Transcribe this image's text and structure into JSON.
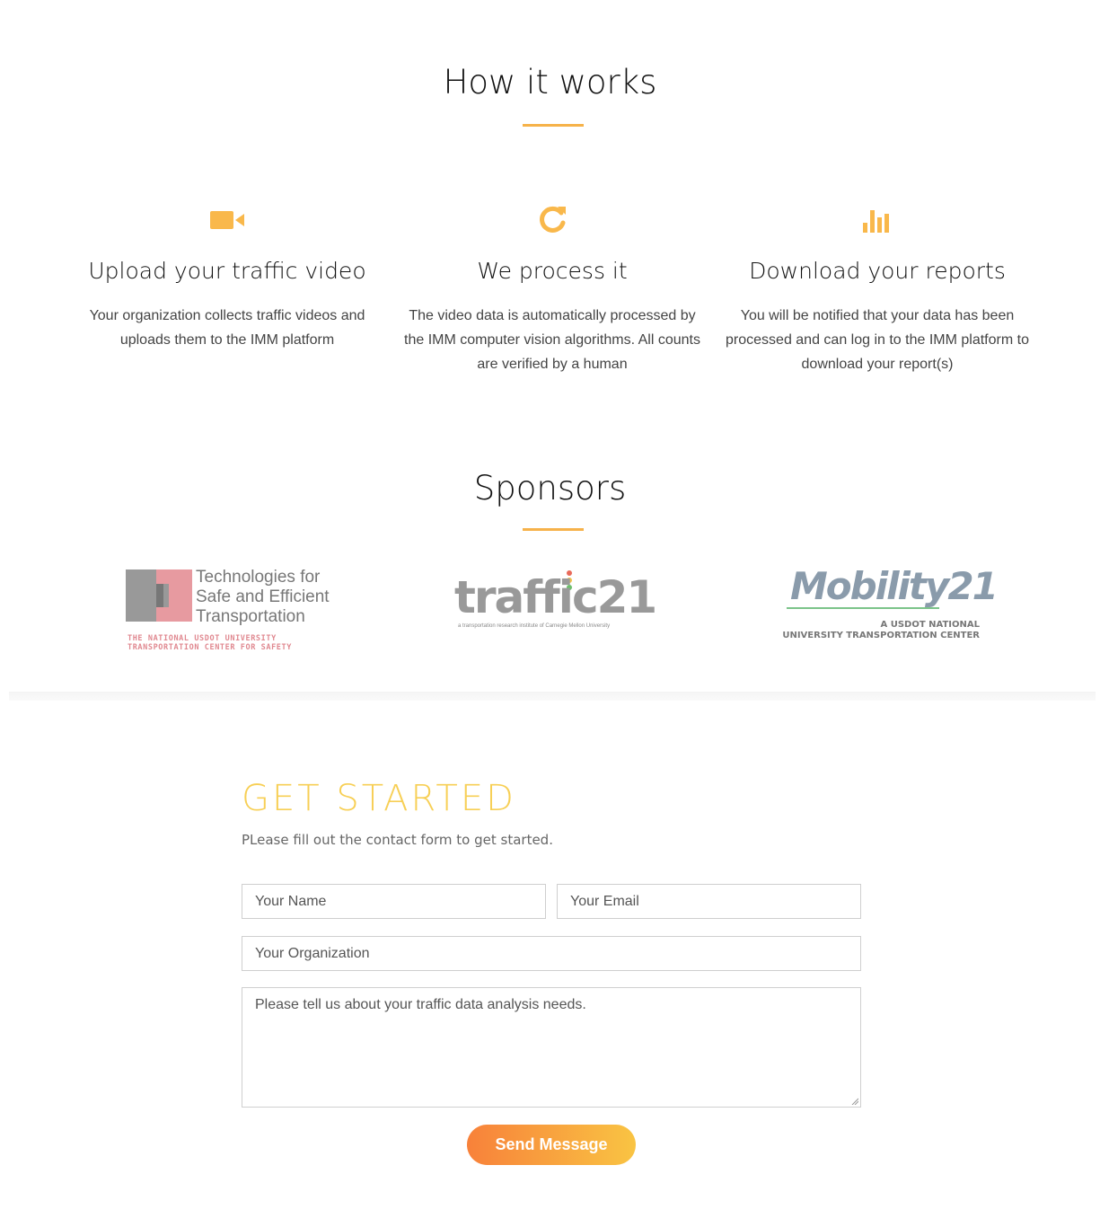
{
  "how_it_works": {
    "title": "How it works",
    "steps": [
      {
        "icon": "video-camera-icon",
        "title": "Upload your traffic video",
        "text": "Your organization collects traffic videos and uploads them to the IMM platform"
      },
      {
        "icon": "refresh-icon",
        "title": "We process it",
        "text": "The video data is automatically processed by the IMM computer vision algorithms. All counts are verified by a human"
      },
      {
        "icon": "bar-chart-icon",
        "title": "Download your reports",
        "text": "You will be notified that your data has been processed and can log in to the IMM platform to download your report(s)"
      }
    ]
  },
  "sponsors": {
    "title": "Sponsors",
    "logos": [
      {
        "name": "safety21-logo",
        "line1": "Technologies for",
        "line2": "Safe and Efficient",
        "line3": "Transportation",
        "tag1": "THE NATIONAL USDOT UNIVERSITY",
        "tag2": "TRANSPORTATION CENTER FOR SAFETY"
      },
      {
        "name": "traffic21-logo",
        "word": "traffic21",
        "tag": "a transportation research institute of Carnegie Mellon University"
      },
      {
        "name": "mobility21-logo",
        "word": "Mobility21",
        "tag1": "A USDOT NATIONAL",
        "tag2": "UNIVERSITY TRANSPORTATION CENTER"
      }
    ]
  },
  "get_started": {
    "title": "GET STARTED",
    "subtitle": "PLease fill out the contact form to get started.",
    "name_placeholder": "Your Name",
    "email_placeholder": "Your Email",
    "org_placeholder": "Your Organization",
    "message_placeholder": "Please tell us about your traffic data analysis needs.",
    "send_label": "Send Message"
  },
  "colors": {
    "accent": "#f6b24a",
    "title_yellow": "#f7cf55",
    "button_start": "#f8813a",
    "button_end": "#f9c443"
  }
}
